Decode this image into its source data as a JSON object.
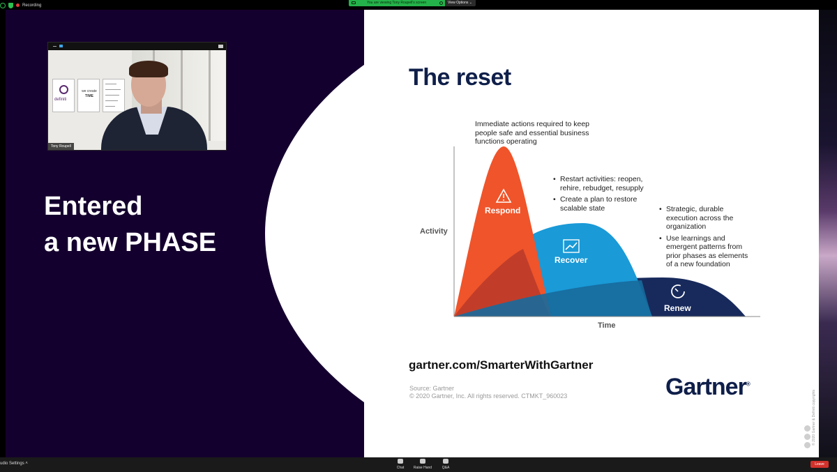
{
  "zoom": {
    "recording_label": "Recording",
    "viewing_banner": "You are viewing Tony Roupell's screen",
    "view_options_label": "View Options",
    "audio_settings_label": "udio Settings",
    "toolbar": {
      "chat_label": "Chat",
      "raise_hand_label": "Raise Hand",
      "qa_label": "Q&A",
      "leave_label": "Leave"
    },
    "participant_name": "Tony Roupell"
  },
  "webcam": {
    "poster_brand": "definiti",
    "poster_tagline_1": "we create",
    "poster_tagline_2": "TIME"
  },
  "slide": {
    "left_text_line1": "Entered",
    "left_text_line2": "a new PHASE",
    "title": "The reset",
    "chart": {
      "top_note": [
        "Immediate actions required to keep",
        "people safe and essential business",
        "functions operating"
      ],
      "recover_notes": [
        [
          "Restart activities: reopen,",
          "rehire, rebudget, resupply"
        ],
        [
          "Create a plan to restore",
          "scalable state"
        ]
      ],
      "renew_notes": [
        [
          "Strategic, durable",
          "execution across the",
          "organization"
        ],
        [
          "Use learnings and",
          "emergent patterns from",
          "prior phases as elements",
          "of a new foundation"
        ]
      ],
      "phase_respond": "Respond",
      "phase_recover": "Recover",
      "phase_renew": "Renew",
      "ylabel": "Activity",
      "xlabel": "Time",
      "colors": {
        "respond": "#f0542a",
        "recover": "#1a9ad7",
        "renew": "#182a5c"
      }
    },
    "url": "gartner.com/SmarterWithGartner",
    "source_line1": "Source: Gartner",
    "source_line2": "© 2020 Gartner, Inc. All rights reserved. CTMKT_960023",
    "brand": "Gartner",
    "vertical_copyright": "© 2020 Gartner & Definiti copyrights"
  }
}
